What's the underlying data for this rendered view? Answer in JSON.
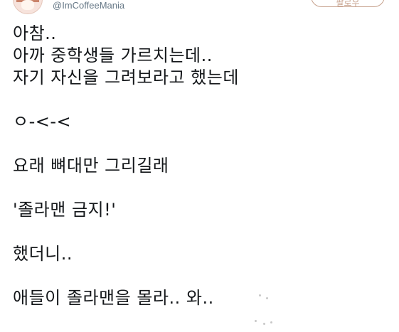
{
  "account": {
    "handle": "@ImCoffeeMania",
    "follow_label": "팔로우"
  },
  "tweet": {
    "lines": [
      "아참..",
      "아까 중학생들 가르치는데..",
      "자기 자신을 그려보라고 했는데",
      "",
      "ㅇ-<-<",
      "",
      "요래 뼈대만 그리길래",
      "",
      "'졸라맨 금지!'",
      "",
      "했더니..",
      "",
      "애들이 졸라맨을 몰라.. 와.."
    ]
  },
  "colors": {
    "text": "#14171a",
    "muted": "#657786",
    "accent": "#c7a28e"
  }
}
